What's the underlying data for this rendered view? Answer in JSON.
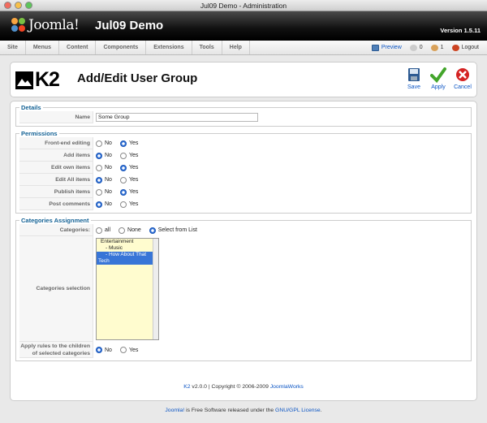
{
  "window": {
    "title": "Jul09 Demo - Administration"
  },
  "header": {
    "logo_text": "Joomla!",
    "site_name": "Jul09 Demo",
    "version": "Version 1.5.11"
  },
  "menu": {
    "items": [
      "Site",
      "Menus",
      "Content",
      "Components",
      "Extensions",
      "Tools",
      "Help"
    ]
  },
  "status": {
    "preview": "Preview",
    "messages": "0",
    "users": "1",
    "logout": "Logout"
  },
  "toolbar": {
    "logo_text": "K2",
    "title": "Add/Edit User Group",
    "save": "Save",
    "apply": "Apply",
    "cancel": "Cancel"
  },
  "details": {
    "legend": "Details",
    "name_label": "Name",
    "name_value": "Some Group"
  },
  "permissions": {
    "legend": "Permissions",
    "rows": [
      {
        "label": "Front-end editing",
        "no": "No",
        "yes": "Yes",
        "selected": "yes"
      },
      {
        "label": "Add items",
        "no": "No",
        "yes": "Yes",
        "selected": "no"
      },
      {
        "label": "Edit own items",
        "no": "No",
        "yes": "Yes",
        "selected": "yes"
      },
      {
        "label": "Edit All items",
        "no": "No",
        "yes": "Yes",
        "selected": "no"
      },
      {
        "label": "Publish items",
        "no": "No",
        "yes": "Yes",
        "selected": "yes"
      },
      {
        "label": "Post comments",
        "no": "No",
        "yes": "Yes",
        "selected": "no"
      }
    ]
  },
  "categories": {
    "legend": "Categories Assignment",
    "categories_label": "Categories:",
    "opt_all": "all",
    "opt_none": "None",
    "opt_select": "Select from List",
    "selection_label": "Categories selection",
    "list": [
      {
        "text": "Entertainment",
        "selected": false
      },
      {
        "text": "- Music",
        "selected": false
      },
      {
        "text": "- How About That",
        "selected": true
      },
      {
        "text": "Tech",
        "selected": true
      }
    ],
    "apply_label_1": "Apply rules to the children",
    "apply_label_2": "of selected categories",
    "apply_no": "No",
    "apply_yes": "Yes"
  },
  "footer_inner": {
    "k2_link": "K2",
    "version_text": "v2.0.0 | Copyright © 2006-2009",
    "works_link": "JoomlaWorks"
  },
  "footer_outer": {
    "joomla_link": "Joomla!",
    "text": "is Free Software released under the",
    "license_link": "GNU/GPL License",
    "dot": "."
  }
}
